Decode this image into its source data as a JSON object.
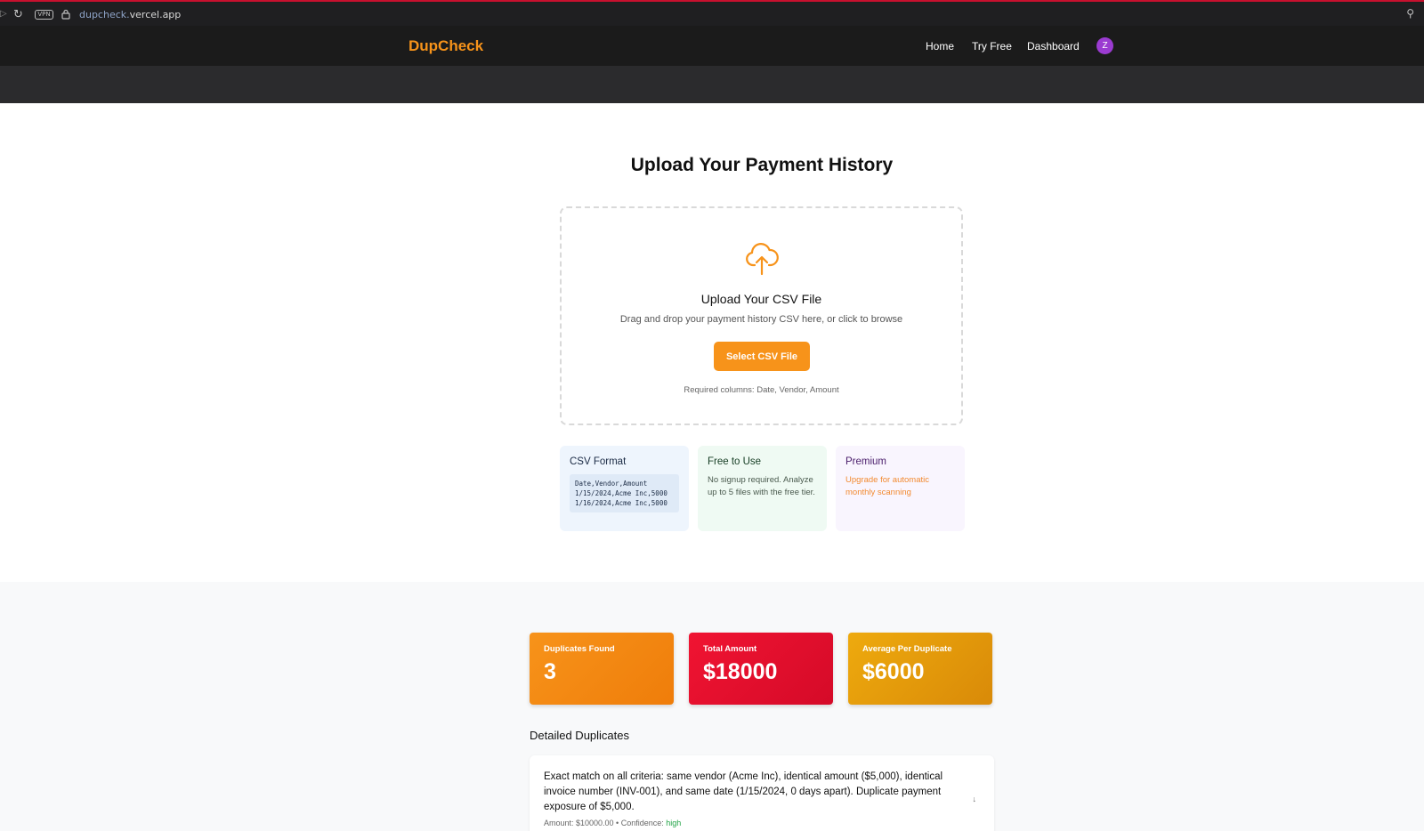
{
  "browser": {
    "url_sub": "dupcheck.",
    "url_main": "vercel.app",
    "vpn_label": "VPN"
  },
  "header": {
    "brand": "DupCheck",
    "nav": [
      "Home",
      "Try Free",
      "Dashboard"
    ],
    "avatar_initial": "Z",
    "brand_color": "#f7931a"
  },
  "upload": {
    "title": "Upload Your Payment History",
    "dropzone_title": "Upload Your CSV File",
    "dropzone_sub": "Drag and drop your payment history CSV here, or click to browse",
    "button_label": "Select CSV File",
    "required": "Required columns: Date, Vendor, Amount"
  },
  "info_cards": {
    "csv": {
      "title": "CSV Format",
      "code": "Date,Vendor,Amount\n1/15/2024,Acme Inc,5000\n1/16/2024,Acme Inc,5000"
    },
    "free": {
      "title": "Free to Use",
      "text": "No signup required. Analyze up to 5 files with the free tier."
    },
    "premium": {
      "title": "Premium",
      "text": "Upgrade for automatic monthly scanning"
    }
  },
  "stats": {
    "duplicates_label": "Duplicates Found",
    "duplicates_value": "3",
    "total_label": "Total Amount",
    "total_value": "$18000",
    "average_label": "Average Per Duplicate",
    "average_value": "$6000"
  },
  "details": {
    "heading": "Detailed Duplicates",
    "items": [
      {
        "description": "Exact match on all criteria: same vendor (Acme Inc), identical amount ($5,000), identical invoice number (INV-001), and same date (1/15/2024, 0 days apart). Duplicate payment exposure of $5,000.",
        "meta_prefix": "Amount: $10000.00 • Confidence: ",
        "confidence": "high"
      }
    ]
  }
}
